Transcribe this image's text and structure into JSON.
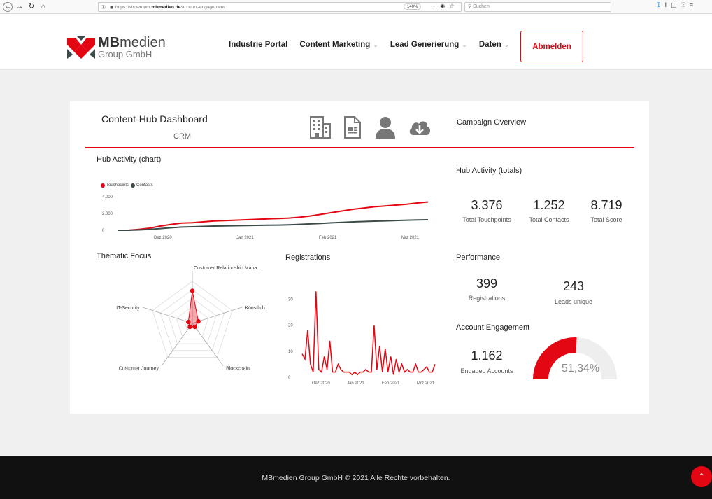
{
  "browser": {
    "url_prefix": "https://showroom.",
    "url_domain": "mbmedien.de",
    "url_path": "/account-engagement",
    "zoom": "140%",
    "search_placeholder": "Suchen"
  },
  "site": {
    "logo_brand_bold": "MB",
    "logo_brand_rest": "medien",
    "logo_sub": "Group GmbH",
    "nav": [
      {
        "label": "Industrie Portal"
      },
      {
        "label": "Content Marketing"
      },
      {
        "label": "Lead Generierung"
      },
      {
        "label": "Daten"
      }
    ],
    "logout_label": "Abmelden"
  },
  "dashboard": {
    "title": "Content-Hub Dashboard",
    "subtitle": "CRM",
    "campaign_overview": "Campaign Overview",
    "hub_activity_chart_title": "Hub Activity (chart)",
    "hub_activity_totals_title": "Hub Activity (totals)",
    "thematic_focus_title": "Thematic Focus",
    "registrations_title": "Registrations",
    "performance_title": "Performance",
    "account_engagement_title": "Account Engagement",
    "totals": {
      "touchpoints_value": "3.376",
      "touchpoints_label": "Total Touchpoints",
      "contacts_value": "1.252",
      "contacts_label": "Total Contacts",
      "score_value": "8.719",
      "score_label": "Total Score"
    },
    "performance": {
      "registrations_value": "399",
      "registrations_label": "Registrations",
      "leads_value": "243",
      "leads_label": "Leads unique"
    },
    "engagement": {
      "accounts_value": "1.162",
      "accounts_label": "Engaged Accounts",
      "gauge_value": "51,34%",
      "gauge_fraction": 0.5134
    },
    "colors": {
      "accent": "#e30613",
      "dark": "#3d4a4a",
      "grey": "#999999"
    }
  },
  "chart_data": [
    {
      "type": "line",
      "title": "Hub Activity (chart)",
      "x_ticks": [
        "Dez 2020",
        "Jan 2021",
        "Feb 2021",
        "Mrz 2021"
      ],
      "ylim": [
        0,
        4000
      ],
      "y_ticks": [
        "0",
        "2.000",
        "4.000"
      ],
      "legend": "top-left",
      "series": [
        {
          "name": "Touchpoints",
          "color": "#e30613",
          "values": [
            0,
            0,
            100,
            250,
            500,
            700,
            850,
            900,
            1000,
            1100,
            1150,
            1200,
            1250,
            1300,
            1350,
            1400,
            1450,
            1550,
            1700,
            1900,
            2100,
            2300,
            2500,
            2650,
            2800,
            2900,
            3000,
            3100,
            3250,
            3376
          ]
        },
        {
          "name": "Contacts",
          "color": "#3d4a4a",
          "values": [
            0,
            0,
            40,
            100,
            200,
            300,
            380,
            420,
            460,
            500,
            520,
            540,
            560,
            580,
            600,
            620,
            650,
            700,
            760,
            820,
            880,
            940,
            1000,
            1040,
            1080,
            1120,
            1160,
            1200,
            1230,
            1252
          ]
        }
      ]
    },
    {
      "type": "radar",
      "title": "Thematic Focus",
      "categories": [
        "Customer Relationship Mana...",
        "Künstlich...",
        "Blockchain",
        "Customer Journey",
        "IT-Security"
      ],
      "values": [
        0.62,
        0.12,
        0.08,
        0.08,
        0.08
      ]
    },
    {
      "type": "line",
      "title": "Registrations",
      "x_ticks": [
        "Dez 2020",
        "Jan 2021",
        "Feb 2021",
        "Mrz 2021"
      ],
      "y_ticks": [
        "0",
        "10",
        "20",
        "30"
      ],
      "ylim": [
        0,
        35
      ],
      "series": [
        {
          "name": "Registrations",
          "color": "#e30613",
          "values": [
            9,
            7,
            18,
            5,
            2,
            33,
            3,
            2,
            8,
            3,
            14,
            2,
            2,
            5,
            3,
            2,
            2,
            2,
            1,
            2,
            1,
            2,
            2,
            3,
            2,
            2,
            20,
            3,
            12,
            2,
            11,
            2,
            8,
            1,
            7,
            2,
            5,
            2,
            3,
            2,
            2,
            5,
            2,
            2,
            3,
            4,
            2,
            2,
            5
          ]
        }
      ]
    },
    {
      "type": "gauge",
      "title": "Account Engagement",
      "value": 0.5134,
      "label": "51,34%"
    }
  ]
}
